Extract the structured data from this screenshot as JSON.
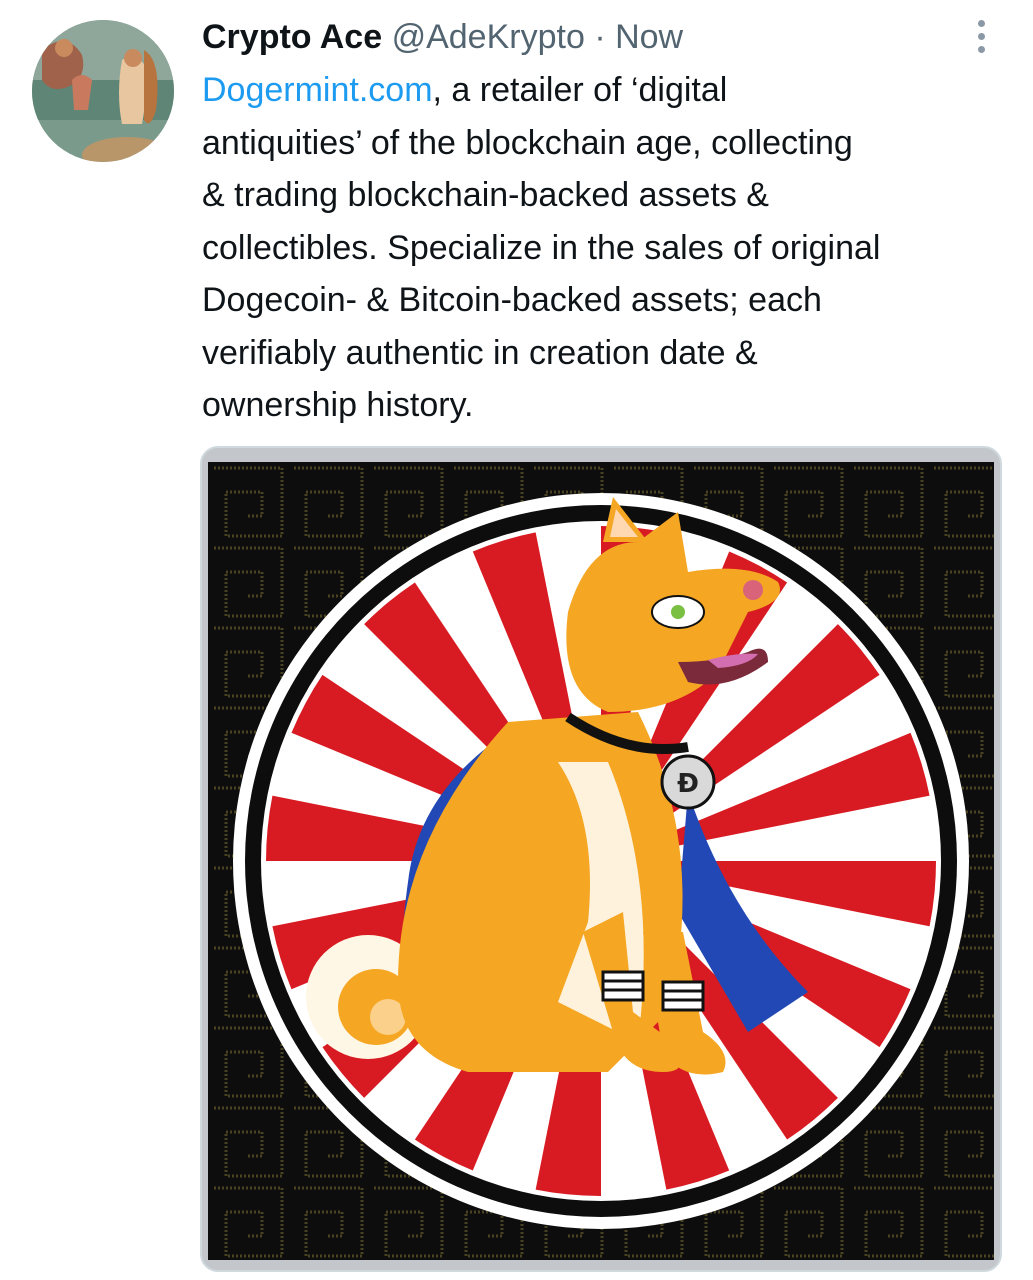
{
  "tweet": {
    "author": {
      "name": "Crypto Ace",
      "handle": "@AdeKrypto",
      "separator": "·",
      "time": "Now",
      "avatar_icon": "venus-painting-avatar"
    },
    "more_icon": "more-vertical-icon",
    "text": {
      "link": "Dogermint.com",
      "line1_rest": ", a retailer of ‘digital",
      "line2": "antiquities’ of the blockchain age, collecting",
      "line3": "& trading blockchain-backed assets &",
      "line4": "collectibles. Specialize in the sales of original",
      "line5": "Dogecoin- & Bitcoin-backed assets; each",
      "line6": "verifiably authentic in creation date &",
      "line7": "ownership history."
    },
    "media": {
      "image_icon": "shiba-superhero-image",
      "colors": {
        "ray_red": "#d81b22",
        "background": "#0d0d0d",
        "dog": "#f5a623",
        "cape": "#2148b5"
      }
    }
  }
}
